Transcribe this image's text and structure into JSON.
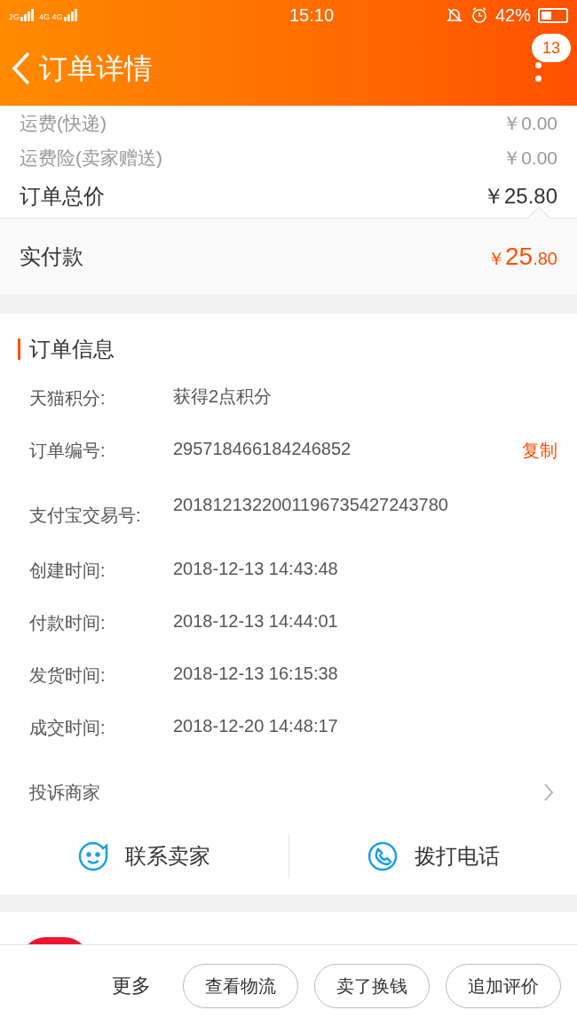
{
  "status_bar": {
    "signal_labels": [
      "2G",
      "4G 4G"
    ],
    "time": "15:10",
    "battery": "42%"
  },
  "header": {
    "title": "订单详情",
    "badge": "13"
  },
  "price_rows": [
    {
      "label": "运费(快递)",
      "value": "￥0.00",
      "kind": "minor"
    },
    {
      "label": "运费险(卖家赠送)",
      "value": "￥0.00",
      "kind": "minor"
    },
    {
      "label": "订单总价",
      "value": "￥25.80",
      "kind": "total"
    }
  ],
  "paid": {
    "label": "实付款",
    "currency": "￥",
    "whole": "25",
    "fraction": ".80"
  },
  "order_info": {
    "title": "订单信息",
    "rows": [
      {
        "label": "天猫积分:",
        "value": "获得2点积分"
      },
      {
        "label": "订单编号:",
        "value": "295718466184246852",
        "action": "复制"
      },
      {
        "label": "支付宝交易号:",
        "value": "2018121322001196735427243780"
      },
      {
        "label": "创建时间:",
        "value": "2018-12-13 14:43:48"
      },
      {
        "label": "付款时间:",
        "value": "2018-12-13 14:44:01"
      },
      {
        "label": "发货时间:",
        "value": "2018-12-13 16:15:38"
      },
      {
        "label": "成交时间:",
        "value": "2018-12-20 14:48:17"
      }
    ],
    "complaint": "投诉商家",
    "contacts": [
      {
        "label": "联系卖家",
        "kind": "chat"
      },
      {
        "label": "拨打电话",
        "kind": "phone"
      }
    ]
  },
  "bottom_bar": {
    "more": "更多",
    "buttons": [
      "查看物流",
      "卖了换钱",
      "追加评价"
    ]
  }
}
